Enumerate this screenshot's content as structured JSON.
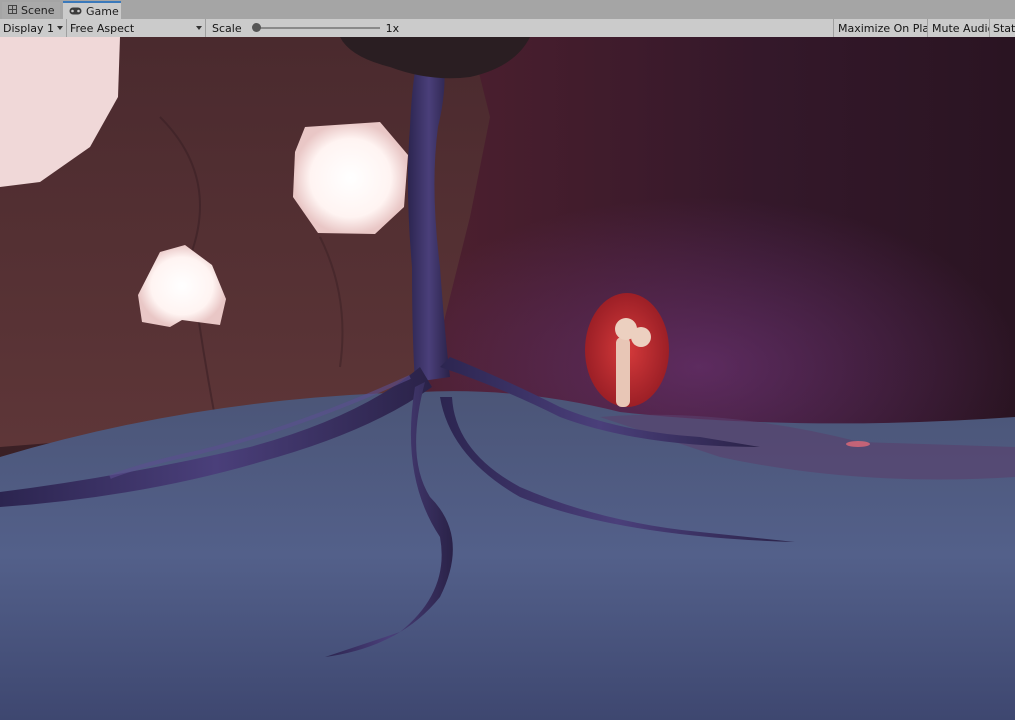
{
  "tabs": [
    {
      "label": "Scene",
      "icon": "grid-icon",
      "active": false
    },
    {
      "label": "Game",
      "icon": "gamepad-icon",
      "active": true
    }
  ],
  "toolbar": {
    "display_select": "Display 1",
    "aspect_select": "Free Aspect",
    "scale_label": "Scale",
    "scale_value": "1x",
    "scale_fraction": 0.0,
    "maximize_on_play": "Maximize On Play",
    "mute_audio": "Mute Audio",
    "stats": "Stats"
  },
  "colors": {
    "tab_accent": "#3a79bb",
    "toolbar_bg": "#cbcbcb",
    "tabbar_bg": "#a5a5a5"
  }
}
